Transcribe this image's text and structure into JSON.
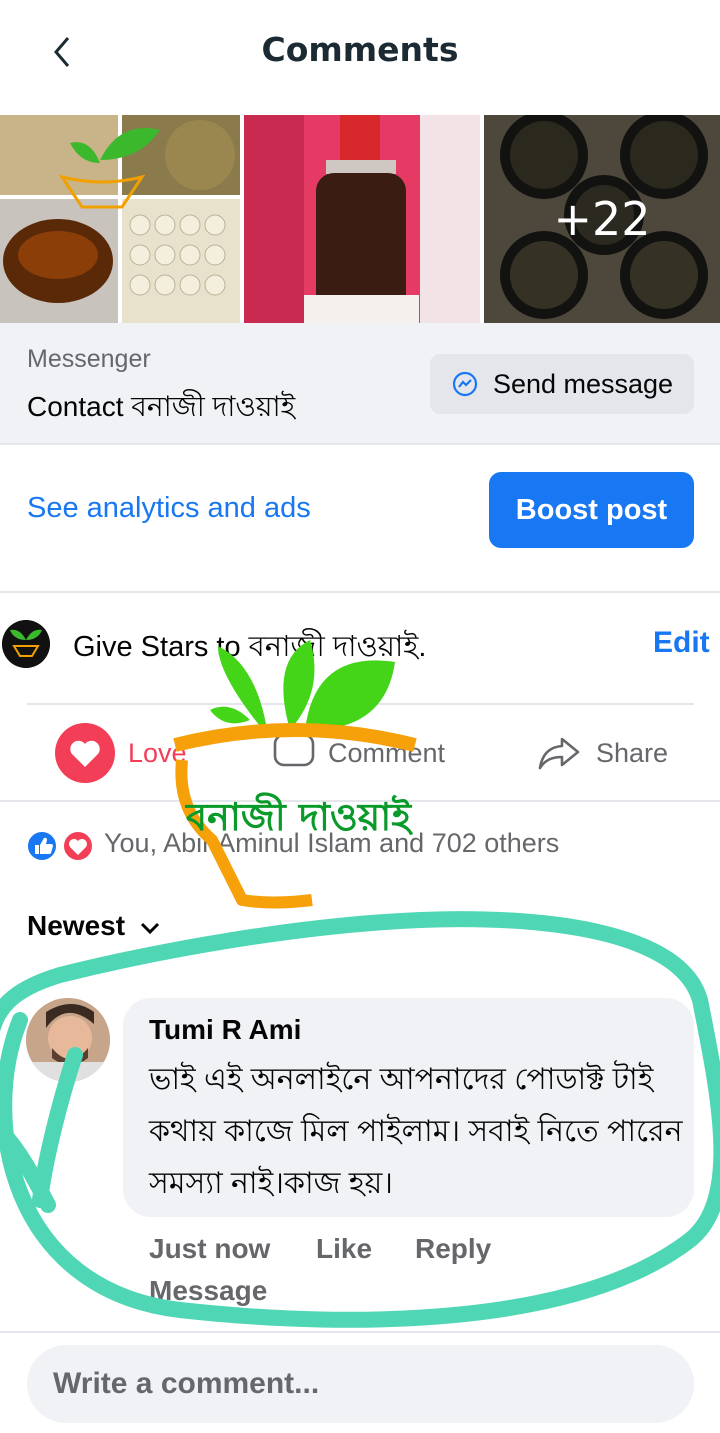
{
  "header": {
    "title": "Comments"
  },
  "photos": {
    "more_count": "+22"
  },
  "messenger": {
    "label": "Messenger",
    "contact": "Contact বনাজী দাওয়াই",
    "send_label": "Send message"
  },
  "promo": {
    "analytics_label": "See analytics and ads",
    "boost_label": "Boost post"
  },
  "stars": {
    "text": "Give Stars to বনাজী দাওয়াই.",
    "edit_label": "Edit"
  },
  "actions": {
    "love_label": "Love",
    "comment_label": "Comment",
    "share_label": "Share"
  },
  "watermark": {
    "text": "বনাজী দাওয়াই"
  },
  "reactions": {
    "summary": "You, Abir Aminul Islam and 702 others"
  },
  "sort": {
    "label": "Newest"
  },
  "comment": {
    "author": "Tumi R Ami",
    "text": "ভাই এই অনলাইনে আপনাদের পোডাক্ট টাই কথায় কাজে মিল পাইলাম। সবাই নিতে পারেন সমস্যা নাই।কাজ হয়।",
    "time": "Just now",
    "like_label": "Like",
    "reply_label": "Reply",
    "message_label": "Message"
  },
  "composer": {
    "placeholder": "Write a comment..."
  },
  "colors": {
    "accent": "#1877f2",
    "love": "#f33e58",
    "highlight": "#4fd6b5"
  }
}
